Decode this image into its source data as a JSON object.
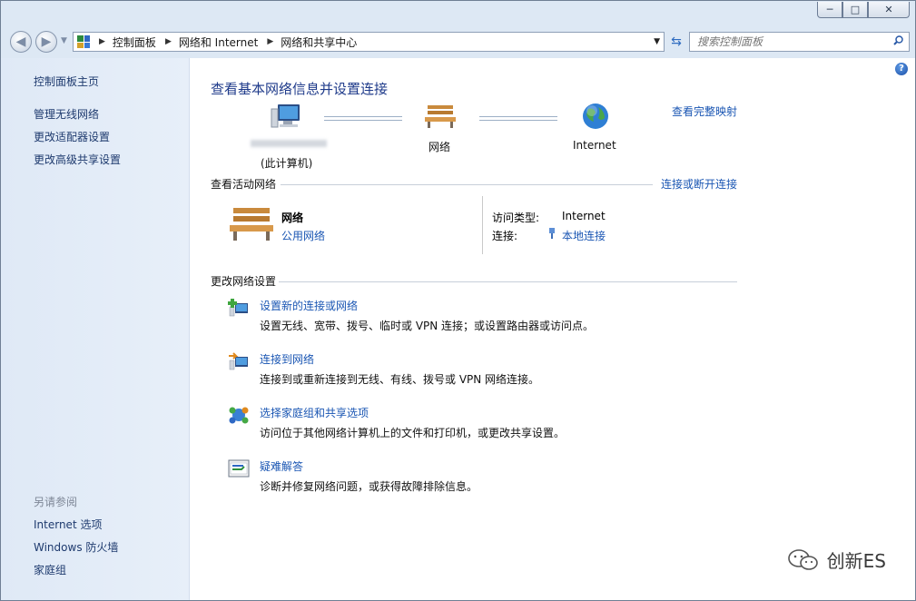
{
  "window": {
    "min_glyph": "─",
    "max_glyph": "□",
    "close_glyph": "✕"
  },
  "address": {
    "crumbs": [
      "控制面板",
      "网络和 Internet",
      "网络和共享中心"
    ],
    "search_placeholder": "搜索控制面板"
  },
  "sidebar": {
    "home": "控制面板主页",
    "links": [
      "管理无线网络",
      "更改适配器设置",
      "更改高级共享设置"
    ],
    "see_also_heading": "另请参阅",
    "see_also": [
      "Internet 选项",
      "Windows 防火墙",
      "家庭组"
    ]
  },
  "main": {
    "title": "查看基本网络信息并设置连接",
    "full_map_link": "查看完整映射",
    "map": {
      "computer_sub": "(此计算机)",
      "network": "网络",
      "internet": "Internet"
    },
    "active": {
      "heading": "查看活动网络",
      "connect_link": "连接或断开连接",
      "network_name": "网络",
      "network_type": "公用网络",
      "access_label": "访问类型:",
      "access_value": "Internet",
      "connection_label": "连接:",
      "connection_value": "本地连接"
    },
    "change": {
      "heading": "更改网络设置",
      "tasks": [
        {
          "title": "设置新的连接或网络",
          "desc": "设置无线、宽带、拨号、临时或 VPN 连接；或设置路由器或访问点。"
        },
        {
          "title": "连接到网络",
          "desc": "连接到或重新连接到无线、有线、拨号或 VPN 网络连接。"
        },
        {
          "title": "选择家庭组和共享选项",
          "desc": "访问位于其他网络计算机上的文件和打印机，或更改共享设置。"
        },
        {
          "title": "疑难解答",
          "desc": "诊断并修复网络问题，或获得故障排除信息。"
        }
      ]
    }
  },
  "watermark": "创新ES"
}
